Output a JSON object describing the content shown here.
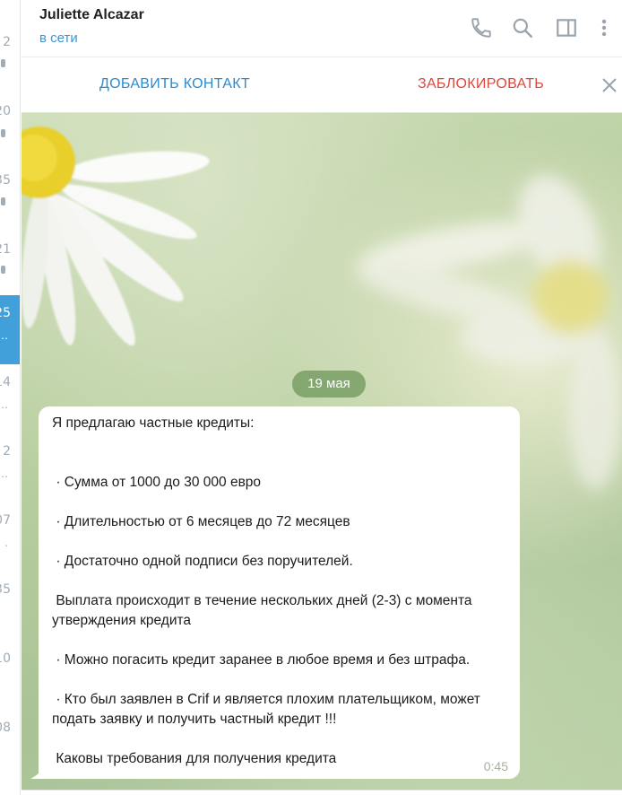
{
  "sidebar": {
    "items": [
      {
        "time": "2",
        "sub": ""
      },
      {
        "time": "20",
        "sub": ""
      },
      {
        "time": "35",
        "sub": ""
      },
      {
        "time": "21",
        "sub": ""
      },
      {
        "time": "25",
        "sub": "…",
        "active": true
      },
      {
        "time": "14",
        "sub": "…"
      },
      {
        "time": "2",
        "sub": "…"
      },
      {
        "time": "07",
        "sub": "."
      },
      {
        "time": "35",
        "sub": ""
      },
      {
        "time": "10",
        "sub": ""
      },
      {
        "time": "08",
        "sub": ""
      }
    ]
  },
  "header": {
    "name": "Juliette Alcazar",
    "status": "в сети",
    "icons": [
      "phone-icon",
      "search-icon",
      "sidebar-panel-icon",
      "more-vertical-icon"
    ]
  },
  "action_bar": {
    "add_contact": "ДОБАВИТЬ КОНТАКТ",
    "block": "ЗАБЛОКИРОВАТЬ"
  },
  "chat": {
    "date": "19 мая",
    "message": {
      "text": "Я предлагаю частные кредиты:\n\n\n · Сумма от 1000 до 30 000 евро\n\n · Длительностью от 6 месяцев до 72 месяцев\n\n · Достаточно одной подписи без поручителей.\n\n Выплата происходит в течение нескольких дней (2-3) с момента утверждения кредита\n\n · Можно погасить кредит заранее в любое время и без штрафа.\n\n · Кто был заявлен в Crif и является плохим плательщиком, может подать заявку и получить частный кредит !!!\n\n Каковы требования для получения кредита",
      "time": "0:45"
    }
  },
  "colors": {
    "accent": "#3a95d7",
    "danger": "#e0473c",
    "active_chat": "#419fd9"
  }
}
